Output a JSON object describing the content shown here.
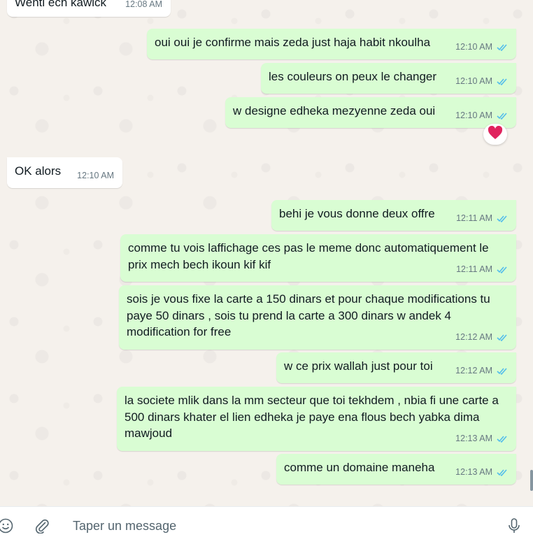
{
  "messages": [
    {
      "text": "Wenti ech kawick",
      "time": "12:08 AM",
      "direction": "in"
    },
    {
      "text": "oui oui je confirme mais zeda just haja habit nkoulha",
      "time": "12:10 AM",
      "direction": "out"
    },
    {
      "text": "les couleurs on peux le changer",
      "time": "12:10 AM",
      "direction": "out"
    },
    {
      "text": "w designe edheka mezyenne zeda oui",
      "time": "12:10 AM",
      "direction": "out",
      "reaction": "heart-emoji"
    },
    {
      "text": "OK alors",
      "time": "12:10 AM",
      "direction": "in"
    },
    {
      "text": "behi je vous donne deux offre",
      "time": "12:11 AM",
      "direction": "out"
    },
    {
      "text": "comme tu vois laffichage ces pas le meme donc automatiquement le prix mech bech ikoun kif kif",
      "time": "12:11 AM",
      "direction": "out"
    },
    {
      "text": "sois je vous fixe la carte a 150 dinars et pour chaque modifications tu paye 50 dinars , sois tu prend la carte a 300 dinars w andek 4 modification for free",
      "time": "12:12 AM",
      "direction": "out"
    },
    {
      "text": "w ce prix wallah just pour toi",
      "time": "12:12 AM",
      "direction": "out"
    },
    {
      "text": "la societe mlik dans la mm secteur que toi tekhdem , nbia fi une carte a 500 dinars khater el lien edheka je paye ena flous bech yabka dima mawjoud",
      "time": "12:13 AM",
      "direction": "out"
    },
    {
      "text": "comme un domaine maneha",
      "time": "12:13 AM",
      "direction": "out"
    }
  ],
  "composer": {
    "placeholder": "Taper un message",
    "emoji_icon": "emoji-icon",
    "attach_icon": "paperclip-icon",
    "mic_icon": "microphone-icon"
  },
  "colors": {
    "outgoing_bubble": "#d9fdd3",
    "incoming_bubble": "#ffffff",
    "read_tick": "#53bdeb",
    "chat_background": "#f5f1ec"
  }
}
